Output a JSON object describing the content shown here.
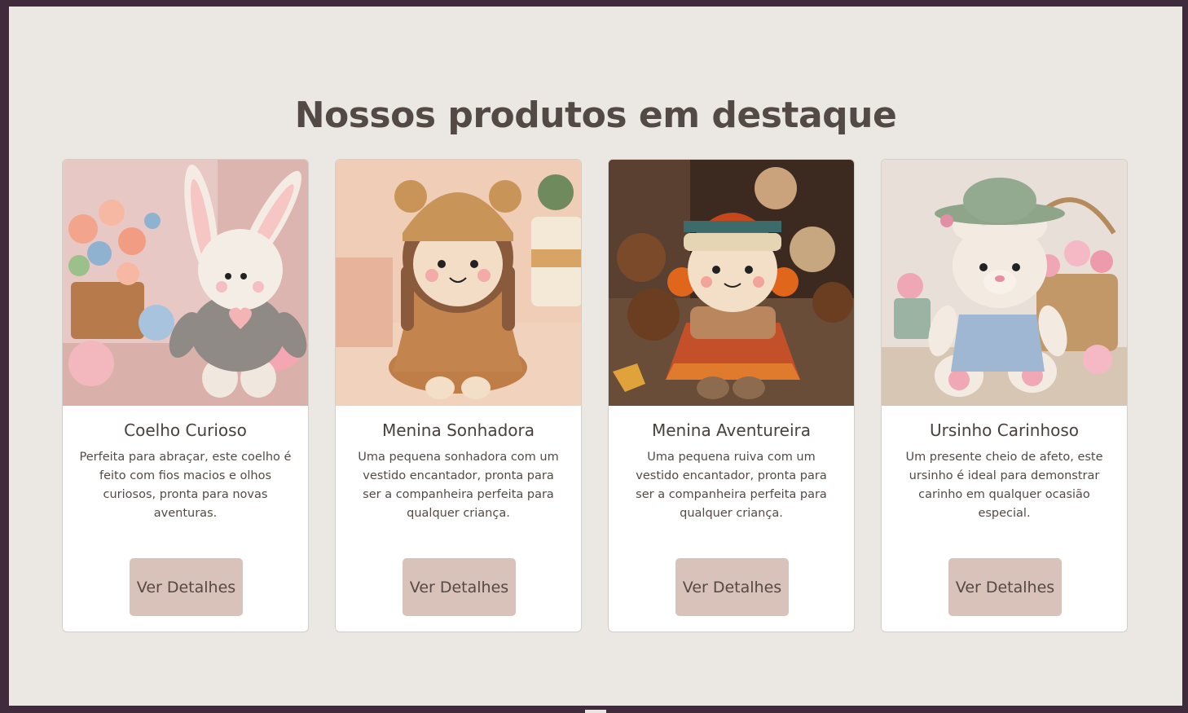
{
  "heading": "Nossos produtos em destaque",
  "products": [
    {
      "name": "Coelho Curioso",
      "description": "Perfeita para abraçar, este coelho é feito com fios macios e olhos curiosos, pronta para novas aventuras.",
      "button": "Ver Detalhes",
      "image": "crochet-bunny-photo"
    },
    {
      "name": "Menina Sonhadora",
      "description": "Uma pequena sonhadora com um vestido encantador, pronta para ser a companheira perfeita para qualquer criança.",
      "button": "Ver Detalhes",
      "image": "crochet-girl-doll-photo"
    },
    {
      "name": "Menina Aventureira",
      "description": "Uma pequena ruiva com um vestido encantador, pronta para ser a companheira perfeita para qualquer criança.",
      "button": "Ver Detalhes",
      "image": "crochet-redhead-doll-photo"
    },
    {
      "name": "Ursinho Carinhoso",
      "description": "Um presente cheio de afeto, este ursinho é ideal para demonstrar carinho em qualquer ocasião especial.",
      "button": "Ver Detalhes",
      "image": "crochet-teddy-bear-photo"
    }
  ],
  "colors": {
    "background": "#ebe8e4",
    "frame": "#3f2b3b",
    "button": "#d9c2b9",
    "text": "#544a45"
  }
}
